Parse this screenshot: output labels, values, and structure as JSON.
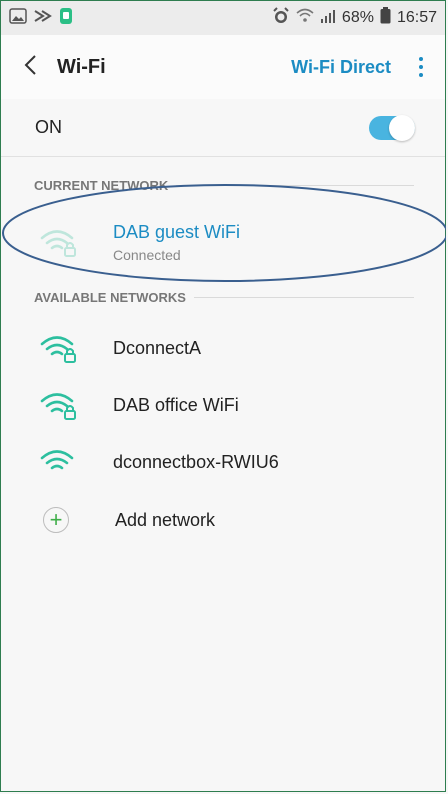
{
  "status_bar": {
    "battery": "68%",
    "time": "16:57"
  },
  "app_bar": {
    "title": "Wi-Fi",
    "action": "Wi-Fi Direct"
  },
  "toggle": {
    "label": "ON",
    "state": "on",
    "accent": "#49b4e0"
  },
  "current_network": {
    "header": "CURRENT NETWORK",
    "name": "DAB guest WiFi",
    "status": "Connected",
    "locked": true
  },
  "available_networks": {
    "header": "AVAILABLE NETWORKS",
    "items": [
      {
        "name": "DconnectA",
        "locked": true
      },
      {
        "name": "DAB office WiFi",
        "locked": true
      },
      {
        "name": "dconnectbox-RWIU6",
        "locked": false
      }
    ],
    "add_label": "Add network"
  },
  "colors": {
    "accent_blue": "#1c8cc3",
    "wifi_green": "#2dbf9f",
    "add_green": "#3fae49",
    "annotation_blue": "#3a5f8f"
  }
}
